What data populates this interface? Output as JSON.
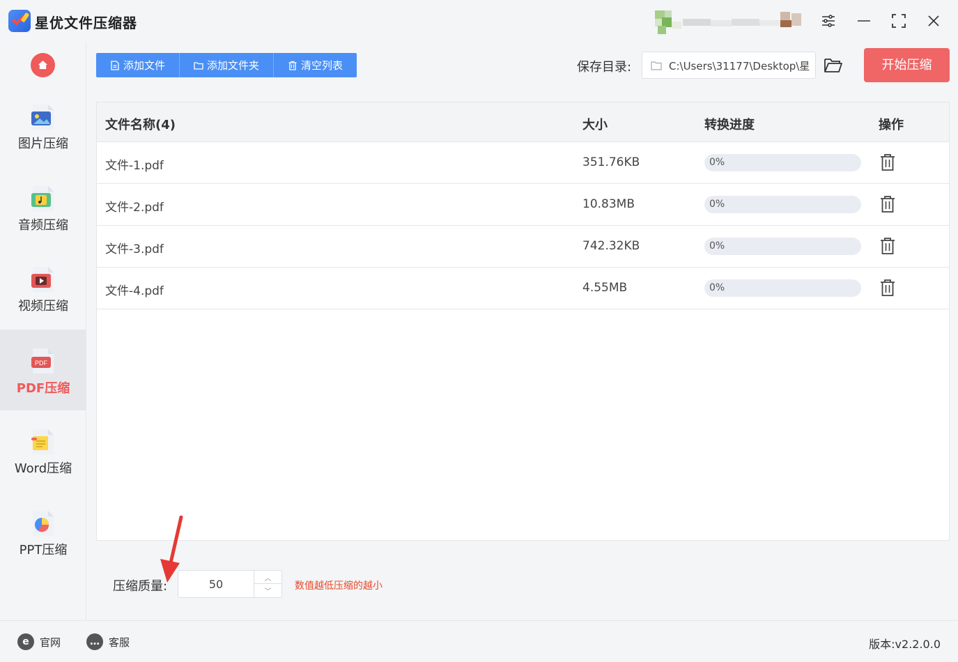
{
  "app": {
    "title": "星优文件压缩器",
    "icons": {
      "logo": "app-logo-icon",
      "settings": "sliders-icon",
      "minimize": "minimize-icon",
      "maximize": "maximize-icon",
      "close": "close-icon"
    }
  },
  "sidebar": {
    "home_icon": "home-icon",
    "items": [
      {
        "label": "图片压缩",
        "icon": "image-file-icon",
        "active": false
      },
      {
        "label": "音频压缩",
        "icon": "audio-file-icon",
        "active": false
      },
      {
        "label": "视频压缩",
        "icon": "video-file-icon",
        "active": false
      },
      {
        "label": "PDF压缩",
        "icon": "pdf-file-icon",
        "active": true
      },
      {
        "label": "Word压缩",
        "icon": "word-file-icon",
        "active": false
      },
      {
        "label": "PPT压缩",
        "icon": "ppt-file-icon",
        "active": false
      }
    ]
  },
  "toolbar": {
    "add_file": "添加文件",
    "add_folder": "添加文件夹",
    "clear_list": "清空列表",
    "save_dir_label": "保存目录:",
    "save_dir_path": "C:\\Users\\31177\\Desktop\\星",
    "start": "开始压缩"
  },
  "table": {
    "headers": {
      "name": "文件名称(4)",
      "size": "大小",
      "progress": "转换进度",
      "action": "操作"
    },
    "rows": [
      {
        "name": "文件-1.pdf",
        "size": "351.76KB",
        "progress_text": "0%",
        "progress": 0
      },
      {
        "name": "文件-2.pdf",
        "size": "10.83MB",
        "progress_text": "0%",
        "progress": 0
      },
      {
        "name": "文件-3.pdf",
        "size": "742.32KB",
        "progress_text": "0%",
        "progress": 0
      },
      {
        "name": "文件-4.pdf",
        "size": "4.55MB",
        "progress_text": "0%",
        "progress": 0
      }
    ]
  },
  "quality": {
    "label": "压缩质量:",
    "value": "50",
    "hint": "数值越低压缩的越小"
  },
  "footer": {
    "website": "官网",
    "support": "客服",
    "version": "版本:v2.2.0.0"
  },
  "colors": {
    "accent_blue": "#4a8ff5",
    "accent_red": "#f06565",
    "hint_red": "#e8492b"
  }
}
